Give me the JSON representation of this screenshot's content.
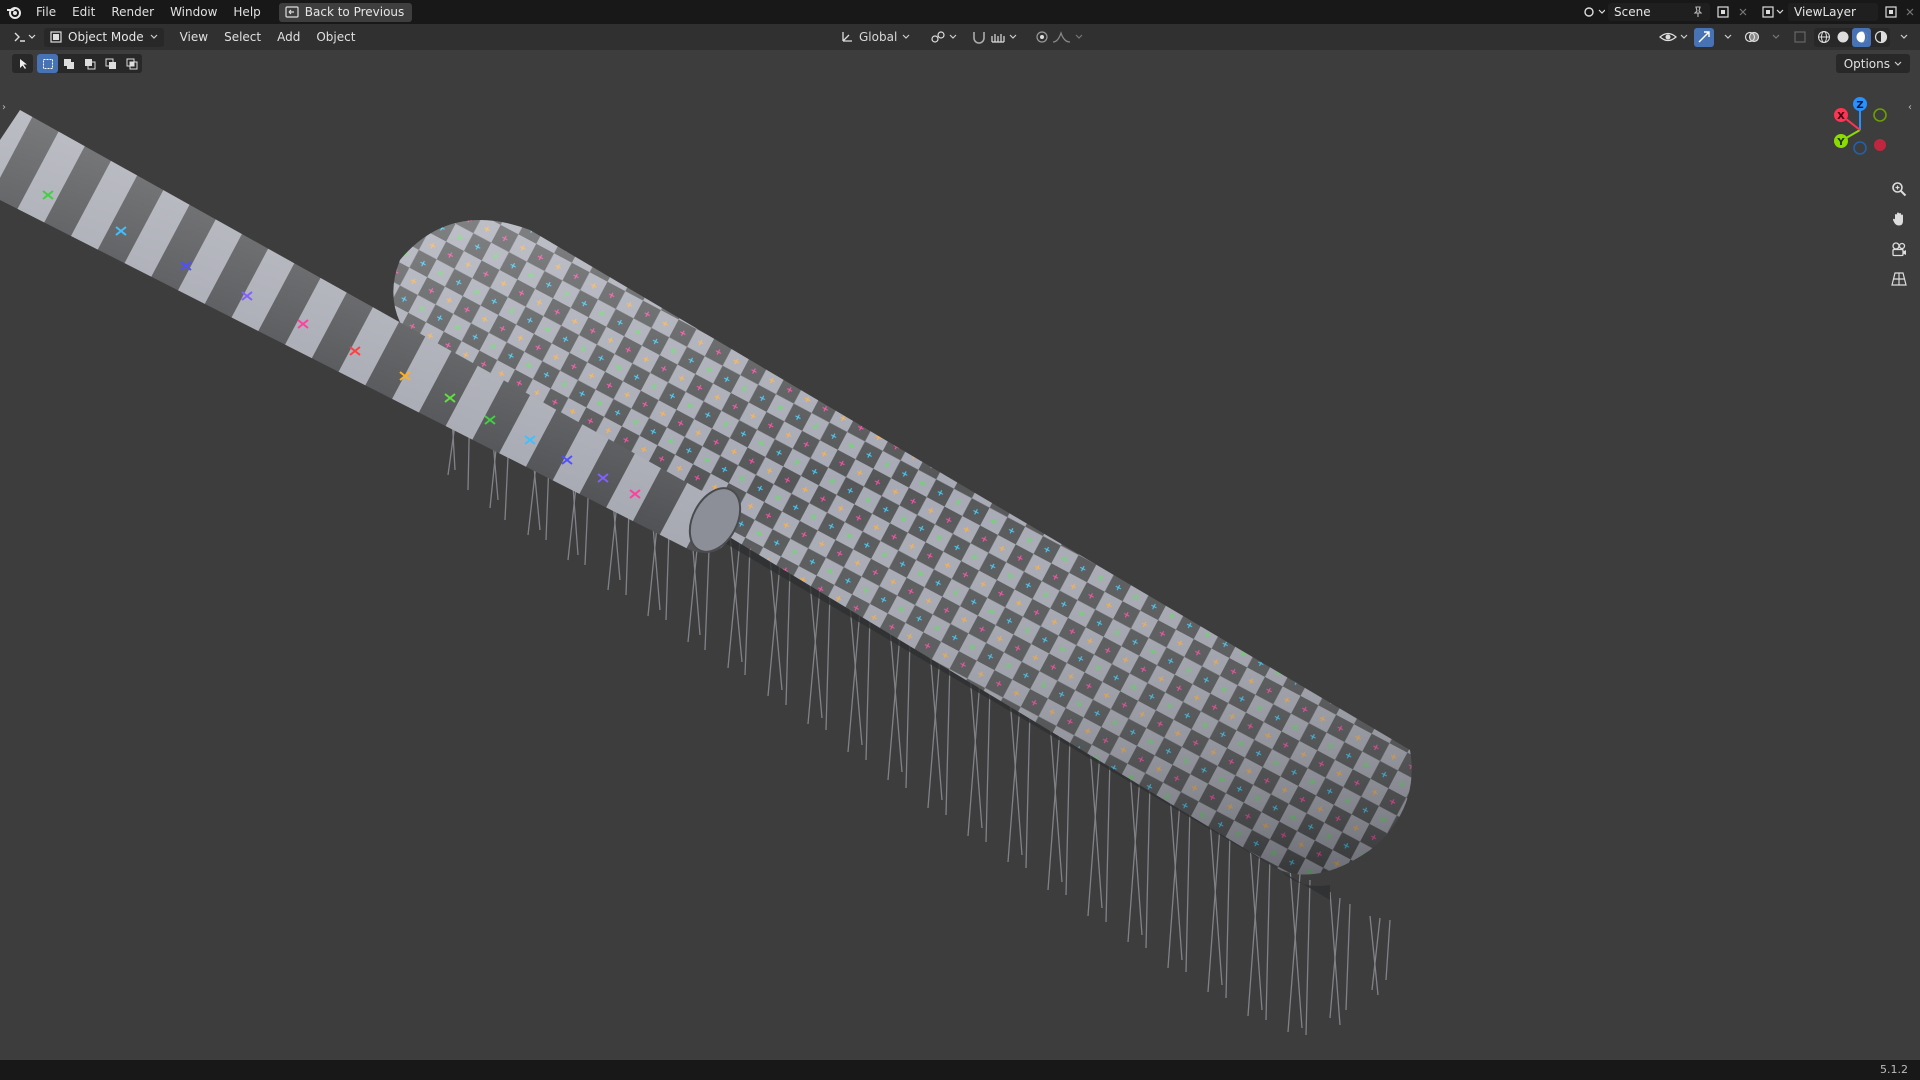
{
  "topbar": {
    "menus": [
      "File",
      "Edit",
      "Render",
      "Window",
      "Help"
    ],
    "back_button": "Back to Previous",
    "scene_name": "Scene",
    "view_layer_name": "ViewLayer"
  },
  "header": {
    "mode": "Object Mode",
    "menus": [
      "View",
      "Select",
      "Add",
      "Object"
    ],
    "transform_orientation": "Global"
  },
  "viewport": {
    "options_label": "Options",
    "gizmo_axes": [
      "X",
      "Y",
      "Z"
    ]
  },
  "statusbar": {
    "version": "5.1.2"
  },
  "colors": {
    "accent": "#4772b3",
    "axis_x": "#ff3352",
    "axis_y": "#8bdc00",
    "axis_z": "#2890ff"
  }
}
